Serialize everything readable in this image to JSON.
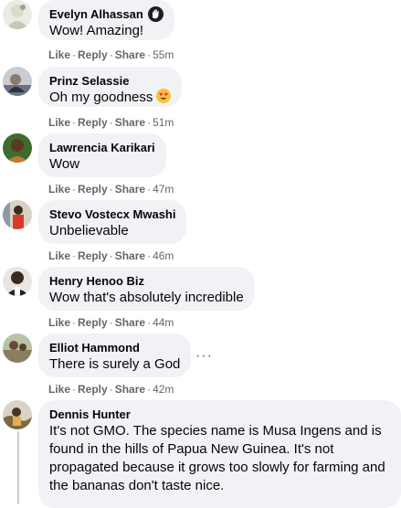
{
  "ui": {
    "dot": "·"
  },
  "comments": [
    {
      "author": "Evelyn Alhassan",
      "text": "Wow! Amazing!",
      "like": "Like",
      "reply": "Reply",
      "share": "Share",
      "time": "55m",
      "badge_icon": "waving-hand-icon"
    },
    {
      "author": "Prinz Selassie",
      "text": "Oh my goodness",
      "like": "Like",
      "reply": "Reply",
      "share": "Share",
      "time": "51m",
      "emoji_icon": "heart-eyes-emoji-icon"
    },
    {
      "author": "Lawrencia Karikari",
      "text": "Wow",
      "like": "Like",
      "reply": "Reply",
      "share": "Share",
      "time": "47m"
    },
    {
      "author": "Stevo Vostecx Mwashi",
      "text": "Unbelievable",
      "like": "Like",
      "reply": "Reply",
      "share": "Share",
      "time": "46m"
    },
    {
      "author": "Henry Henoo Biz",
      "text": "Wow that's absolutely incredible",
      "like": "Like",
      "reply": "Reply",
      "share": "Share",
      "time": "44m"
    },
    {
      "author": "Elliot Hammond",
      "text": "There is surely a God",
      "like": "Like",
      "reply": "Reply",
      "share": "Share",
      "time": "42m",
      "more_icon": "more-options-icon",
      "more_label": "···"
    },
    {
      "author": "Dennis Hunter",
      "text": "It's not GMO. The species name is Musa Ingens and is found in the hills of Papua New Guinea. It's not propagated because it grows too slowly for farming and the bananas don't taste nice."
    }
  ]
}
